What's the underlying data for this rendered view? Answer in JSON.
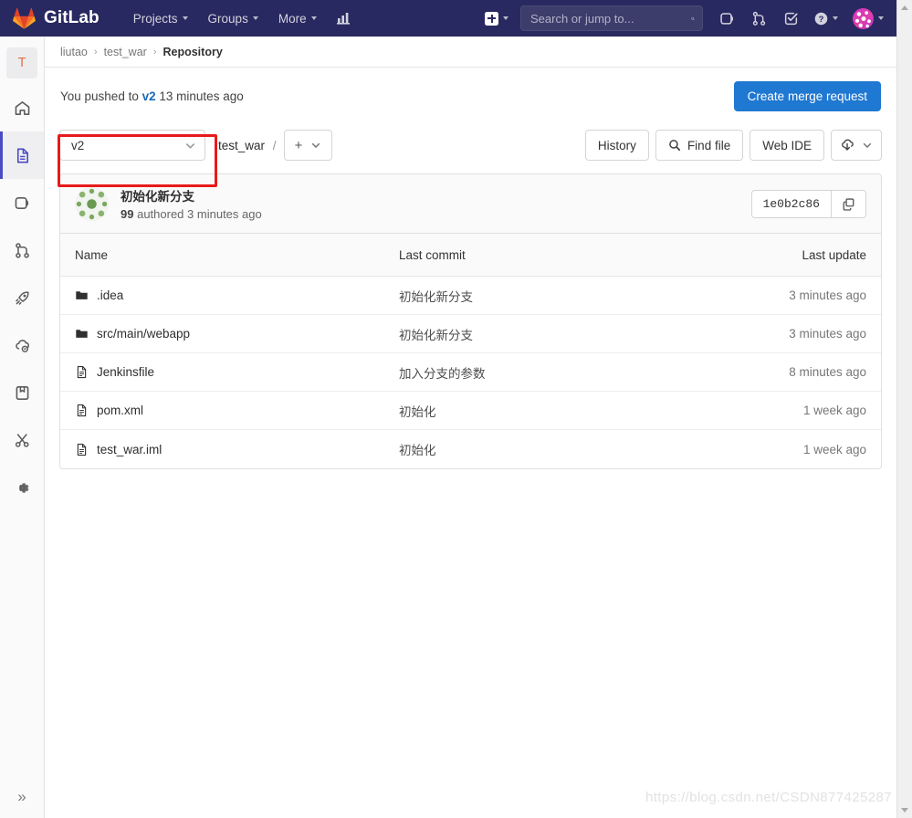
{
  "brand": {
    "name": "GitLab",
    "accent": "#292961",
    "primary": "#1f78d1",
    "link": "#1b69b6",
    "highlight": "#e81a1a"
  },
  "topnav": {
    "items": [
      {
        "label": "Projects",
        "icon": "chevron-down-icon"
      },
      {
        "label": "Groups",
        "icon": "chevron-down-icon"
      },
      {
        "label": "More",
        "icon": "chevron-down-icon"
      }
    ],
    "analytics_icon": "chart-icon",
    "create_new_icon": "plus-square-icon",
    "search": {
      "placeholder": "Search or jump to...",
      "value": "",
      "icon": "search-icon"
    },
    "issues_icon": "issues-icon",
    "merge_requests_icon": "merge-request-icon",
    "todos_icon": "todo-checkbox-icon",
    "help_icon": "question-circle-icon",
    "avatar_icon": "user-avatar"
  },
  "rail": {
    "project_initial": "T",
    "items": [
      {
        "name": "project-overview",
        "icon": "home-icon",
        "active": false
      },
      {
        "name": "repository",
        "icon": "document-icon",
        "active": true
      },
      {
        "name": "issues",
        "icon": "issues-icon",
        "active": false
      },
      {
        "name": "merge-requests",
        "icon": "merge-request-icon",
        "active": false
      },
      {
        "name": "ci-cd",
        "icon": "rocket-icon",
        "active": false
      },
      {
        "name": "operations",
        "icon": "cloud-gear-icon",
        "active": false
      },
      {
        "name": "packages",
        "icon": "package-icon",
        "active": false
      },
      {
        "name": "snippets",
        "icon": "scissors-icon",
        "active": false
      },
      {
        "name": "settings",
        "icon": "gear-icon",
        "active": false
      }
    ],
    "collapse_label": "»"
  },
  "breadcrumb": {
    "namespace": "liutao",
    "project": "test_war",
    "current": "Repository",
    "separator": "›"
  },
  "push_notice": {
    "prefix": "You pushed to",
    "branch": "v2",
    "suffix": "13 minutes ago",
    "action_label": "Create merge request"
  },
  "toolbar": {
    "branch": "v2",
    "branch_caret_icon": "chevron-down-icon",
    "project_path": "test_war",
    "path_separator": "/",
    "add_label": "+",
    "add_caret_icon": "chevron-down-icon",
    "history_label": "History",
    "find_file_label": "Find file",
    "find_file_icon": "search-icon",
    "web_ide_label": "Web IDE",
    "clone_icon": "download-cloud-icon",
    "clone_caret_icon": "chevron-down-icon"
  },
  "commit": {
    "title": "初始化新分支",
    "author": "99",
    "meta_mid": "authored",
    "time": "3 minutes ago",
    "sha": "1e0b2c86",
    "copy_icon": "copy-icon",
    "avatar_icon": "identicon-avatar"
  },
  "files": {
    "headers": {
      "name": "Name",
      "last_commit": "Last commit",
      "last_update": "Last update"
    },
    "rows": [
      {
        "name": ".idea",
        "type": "folder",
        "icon": "folder-icon",
        "last_commit": "初始化新分支",
        "last_update": "3 minutes ago"
      },
      {
        "name": "src/main/webapp",
        "type": "folder",
        "icon": "folder-icon",
        "last_commit": "初始化新分支",
        "last_update": "3 minutes ago"
      },
      {
        "name": "Jenkinsfile",
        "type": "file",
        "icon": "file-icon",
        "last_commit": "加入分支的参数",
        "last_update": "8 minutes ago"
      },
      {
        "name": "pom.xml",
        "type": "file",
        "icon": "file-icon",
        "last_commit": "初始化",
        "last_update": "1 week ago"
      },
      {
        "name": "test_war.iml",
        "type": "file",
        "icon": "file-icon",
        "last_commit": "初始化",
        "last_update": "1 week ago"
      }
    ]
  },
  "watermark": {
    "text": "https://blog.csdn.net/CSDN877425287"
  }
}
